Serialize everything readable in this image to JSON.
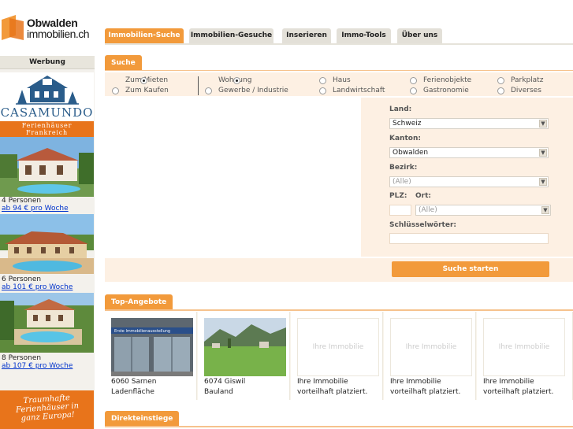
{
  "logo": {
    "line1": "Obwalden",
    "line2": "immobilien.ch"
  },
  "nav": {
    "tabs": [
      {
        "label": "Immobilien-Suche",
        "active": true
      },
      {
        "label": "Immobilien-Gesuche",
        "active": false
      },
      {
        "label": "Inserieren",
        "active": false
      },
      {
        "label": "Immo-Tools",
        "active": false
      },
      {
        "label": "Über uns",
        "active": false
      }
    ]
  },
  "sidebar": {
    "header": "Werbung",
    "ad": {
      "brand": "CASAMUNDO",
      "tagline_line1": "Ferienhäuser",
      "tagline_line2": "Frankreich",
      "listings": [
        {
          "persons": "4 Personen",
          "price": "ab 94 € pro Woche"
        },
        {
          "persons": "6 Personen",
          "price": "ab 101 € pro Woche"
        },
        {
          "persons": "8 Personen",
          "price": "ab 107 € pro Woche "
        }
      ],
      "promo_line1": "Traumhafte",
      "promo_line2": "Ferienhäuser in",
      "promo_line3": "ganz Europa!"
    }
  },
  "search": {
    "section_title": "Suche",
    "transaction": [
      {
        "label": "Zum Mieten",
        "selected": true
      },
      {
        "label": "Zum Kaufen",
        "selected": false
      }
    ],
    "categories": [
      {
        "label": "Wohnung",
        "selected": true
      },
      {
        "label": "Gewerbe / Industrie",
        "selected": false
      },
      {
        "label": "Haus",
        "selected": false
      },
      {
        "label": "Landwirtschaft",
        "selected": false
      },
      {
        "label": "Ferienobjekte",
        "selected": false
      },
      {
        "label": "Gastronomie",
        "selected": false
      },
      {
        "label": "Parkplatz",
        "selected": false
      },
      {
        "label": "Diverses",
        "selected": false
      }
    ],
    "land_label": "Land:",
    "land_value": "Schweiz",
    "kanton_label": "Kanton:",
    "kanton_value": "Obwalden",
    "bezirk_label": "Bezirk:",
    "bezirk_value": "(Alle)",
    "plz_label": "PLZ:",
    "ort_label": "Ort:",
    "ort_value": "(Alle)",
    "keywords_label": "Schlüsselwörter:",
    "submit_label": "Suche starten"
  },
  "top_offers": {
    "section_title": "Top-Angebote",
    "cards": [
      {
        "line1": "6060 Sarnen",
        "line2": "Ladenfläche",
        "image": "storefront-photo",
        "sign": "Erste Immobilienausstellung"
      },
      {
        "line1": "6074 Giswil",
        "line2": "Bauland",
        "image": "meadow-photo"
      },
      {
        "placeholder": "Ihre Immobilie",
        "line1": "Ihre Immobilie",
        "line2": "vorteilhaft platziert."
      },
      {
        "placeholder": "Ihre Immobilie",
        "line1": "Ihre Immobilie",
        "line2": "vorteilhaft platziert."
      },
      {
        "placeholder": "Ihre Immobilie",
        "line1": "Ihre Immobilie",
        "line2": "vorteilhaft platziert."
      }
    ]
  },
  "direct": {
    "section_title": "Direkteinstiege"
  },
  "colors": {
    "accent": "#f29a3b",
    "panel": "#fdf0e3",
    "link": "#0033cc",
    "ad_orange": "#e8741b"
  }
}
